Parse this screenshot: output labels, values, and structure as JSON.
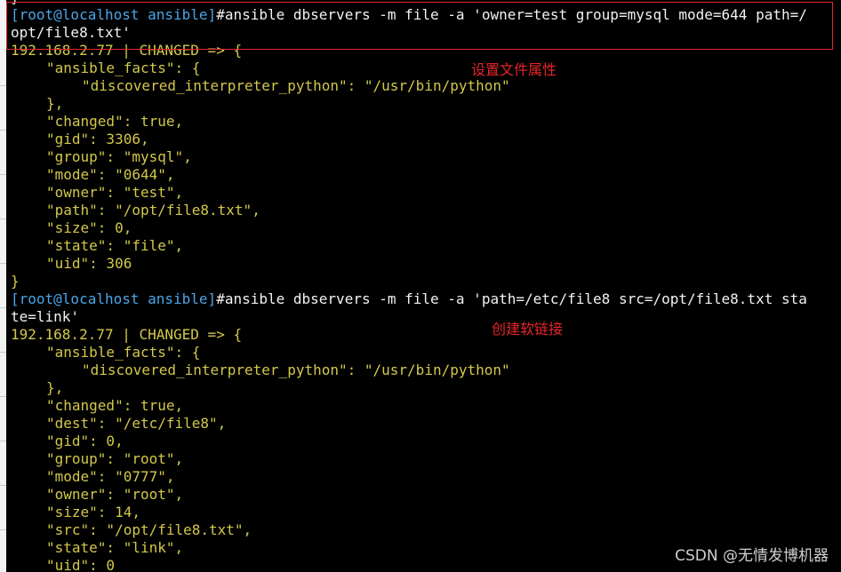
{
  "terminal": {
    "lines": [
      {
        "type": "brace",
        "text": "}"
      },
      {
        "type": "prompt",
        "prompt": "[root@localhost ansible]",
        "symbol": "#",
        "cmd": "ansible dbservers -m file -a 'owner=test group=mysql mode=644 path=/"
      },
      {
        "type": "cont",
        "text": "opt/file8.txt'"
      },
      {
        "type": "ip",
        "text": "192.168.2.77 | CHANGED => {"
      },
      {
        "type": "i1",
        "text": "\"ansible_facts\": {"
      },
      {
        "type": "i2",
        "text": "\"discovered_interpreter_python\": \"/usr/bin/python\""
      },
      {
        "type": "i1",
        "text": "},"
      },
      {
        "type": "i1",
        "text": "\"changed\": true,"
      },
      {
        "type": "i1",
        "text": "\"gid\": 3306,"
      },
      {
        "type": "i1",
        "text": "\"group\": \"mysql\","
      },
      {
        "type": "i1",
        "text": "\"mode\": \"0644\","
      },
      {
        "type": "i1",
        "text": "\"owner\": \"test\","
      },
      {
        "type": "i1",
        "text": "\"path\": \"/opt/file8.txt\","
      },
      {
        "type": "i1",
        "text": "\"size\": 0,"
      },
      {
        "type": "i1",
        "text": "\"state\": \"file\","
      },
      {
        "type": "i1",
        "text": "\"uid\": 306"
      },
      {
        "type": "brace-y",
        "text": "}"
      },
      {
        "type": "prompt",
        "prompt": "[root@localhost ansible]",
        "symbol": "#",
        "cmd": "ansible dbservers -m file -a 'path=/etc/file8 src=/opt/file8.txt sta"
      },
      {
        "type": "cont",
        "text": "te=link'"
      },
      {
        "type": "ip",
        "text": "192.168.2.77 | CHANGED => {"
      },
      {
        "type": "i1",
        "text": "\"ansible_facts\": {"
      },
      {
        "type": "i2",
        "text": "\"discovered_interpreter_python\": \"/usr/bin/python\""
      },
      {
        "type": "i1",
        "text": "},"
      },
      {
        "type": "i1",
        "text": "\"changed\": true,"
      },
      {
        "type": "i1",
        "text": "\"dest\": \"/etc/file8\","
      },
      {
        "type": "i1",
        "text": "\"gid\": 0,"
      },
      {
        "type": "i1",
        "text": "\"group\": \"root\","
      },
      {
        "type": "i1",
        "text": "\"mode\": \"0777\","
      },
      {
        "type": "i1",
        "text": "\"owner\": \"root\","
      },
      {
        "type": "i1",
        "text": "\"size\": 14,"
      },
      {
        "type": "i1",
        "text": "\"src\": \"/opt/file8.txt\","
      },
      {
        "type": "i1",
        "text": "\"state\": \"link\","
      },
      {
        "type": "i1",
        "text": "\"uid\": 0"
      }
    ]
  },
  "annotations": {
    "note_set_attributes": "设置文件属性",
    "note_create_symlink": "创建软链接"
  },
  "watermark": "CSDN @无情发博机器",
  "colors": {
    "background": "#000000",
    "prompt": "#4aa6e8",
    "command": "#f2f2f2",
    "output": "#d3c84a",
    "annotation": "#e8262a"
  }
}
